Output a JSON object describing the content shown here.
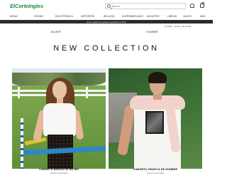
{
  "header": {
    "logo_text": "ElCorteIngles",
    "search_placeholder": "Buscar",
    "icons": [
      "search-icon",
      "user-icon",
      "bag-icon"
    ]
  },
  "categories": [
    "Moda",
    "Hogar",
    "Electrónica",
    "Deportes",
    "Belleza",
    "Supermercado",
    "Juguetes",
    "Libros",
    "Viajes",
    "Más"
  ],
  "promo_bar": "Envío gratis en pedidos superiores a 50 €",
  "sub_row": {
    "left": "",
    "right": "Tiendas · Ayuda · Mi cuenta"
  },
  "section_nav": {
    "left": "Mujer",
    "right": "Hombre"
  },
  "headline": "NEW COLLECTION",
  "tiles": [
    {
      "caption": "Camiseta básica de mujer",
      "subcaption": "Nueva temporada"
    },
    {
      "caption": "Camiseta gráfica de hombre",
      "subcaption": "Nueva temporada"
    }
  ],
  "colors": {
    "brand_green": "#1e8f3a",
    "promo_bar": "#2b2b2b"
  }
}
